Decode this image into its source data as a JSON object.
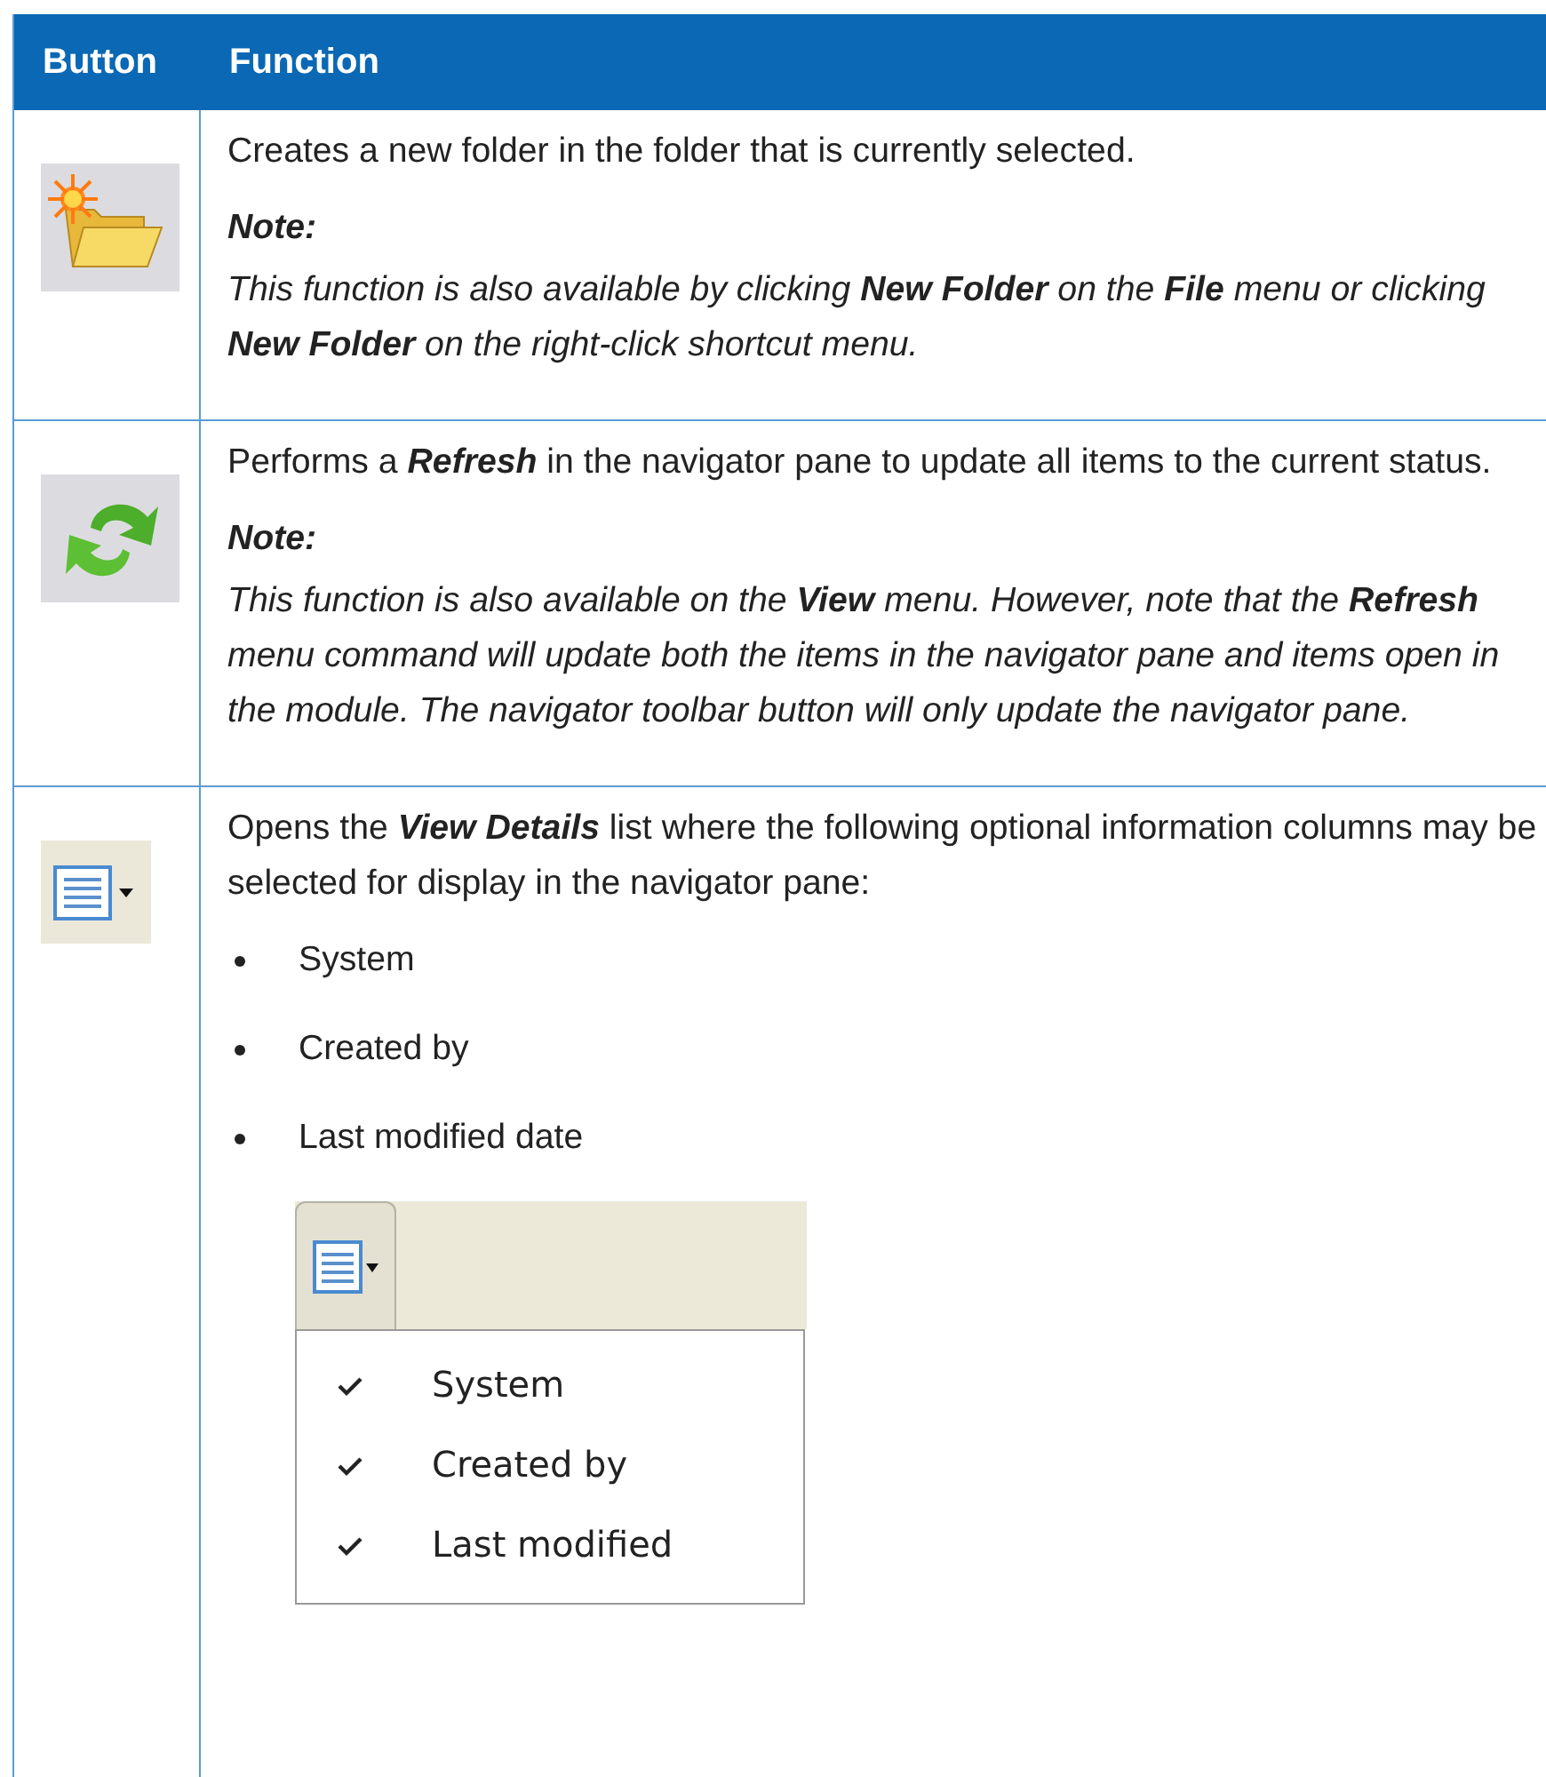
{
  "table": {
    "columns": [
      "Button",
      "Function"
    ],
    "rows": [
      {
        "kind": "new-folder",
        "content": [
          {
            "kind": "text",
            "text": "Creates a new folder in the folder that is currently selected."
          },
          {
            "kind": "note_label",
            "text": "Note:"
          },
          {
            "kind": "note",
            "text": "This function is also available by clicking **New Folder** on the **File** menu or clicking **New Folder** on the right-click shortcut menu."
          }
        ]
      },
      {
        "kind": "refresh",
        "content": [
          {
            "kind": "text",
            "text": "Performs a **Refresh** in the navigator pane to update all items to the current status."
          },
          {
            "kind": "note_label",
            "text": "Note:"
          },
          {
            "kind": "note",
            "text": "This function is also available on the **View** menu. However, note that the **Refresh** menu command will update both the items in the navigator pane and items open in the module. The navigator toolbar button will only update the navigator pane."
          }
        ]
      },
      {
        "kind": "view-details",
        "content": [
          {
            "kind": "text",
            "text": "Opens the **View Details** list where the following optional information columns may be selected for display in the navigator pane:"
          },
          {
            "kind": "bullet",
            "text": "System"
          },
          {
            "kind": "bullet",
            "text": "Created by"
          },
          {
            "kind": "bullet",
            "text": "Last modified date"
          },
          {
            "kind": "menu_screenshot",
            "items": [
              {
                "label": "System",
                "checked": true
              },
              {
                "label": "Created by",
                "checked": true
              },
              {
                "label": "Last modified",
                "checked": true
              }
            ]
          }
        ]
      }
    ]
  }
}
